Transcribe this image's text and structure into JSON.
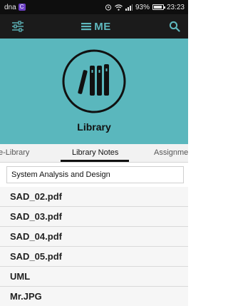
{
  "status_bar": {
    "carrier": "dna",
    "carrier_badge": "C",
    "battery": "93%",
    "time": "23:23",
    "battery_level": 0.93
  },
  "app_bar": {
    "logo_text": "ME",
    "left_icon": "filter-sliders-icon",
    "right_icon": "search-icon"
  },
  "hero": {
    "title": "Library",
    "emblem_icon": "books-icon",
    "background": "#5ab7bd"
  },
  "tabs": [
    {
      "label": "e-Library"
    },
    {
      "label": "Library Notes",
      "active": true
    },
    {
      "label": "Assignme"
    }
  ],
  "search": {
    "value": "System Analysis and Design"
  },
  "files": [
    "SAD_02.pdf",
    "SAD_03.pdf",
    "SAD_04.pdf",
    "SAD_05.pdf",
    "UML",
    "Mr.JPG"
  ]
}
